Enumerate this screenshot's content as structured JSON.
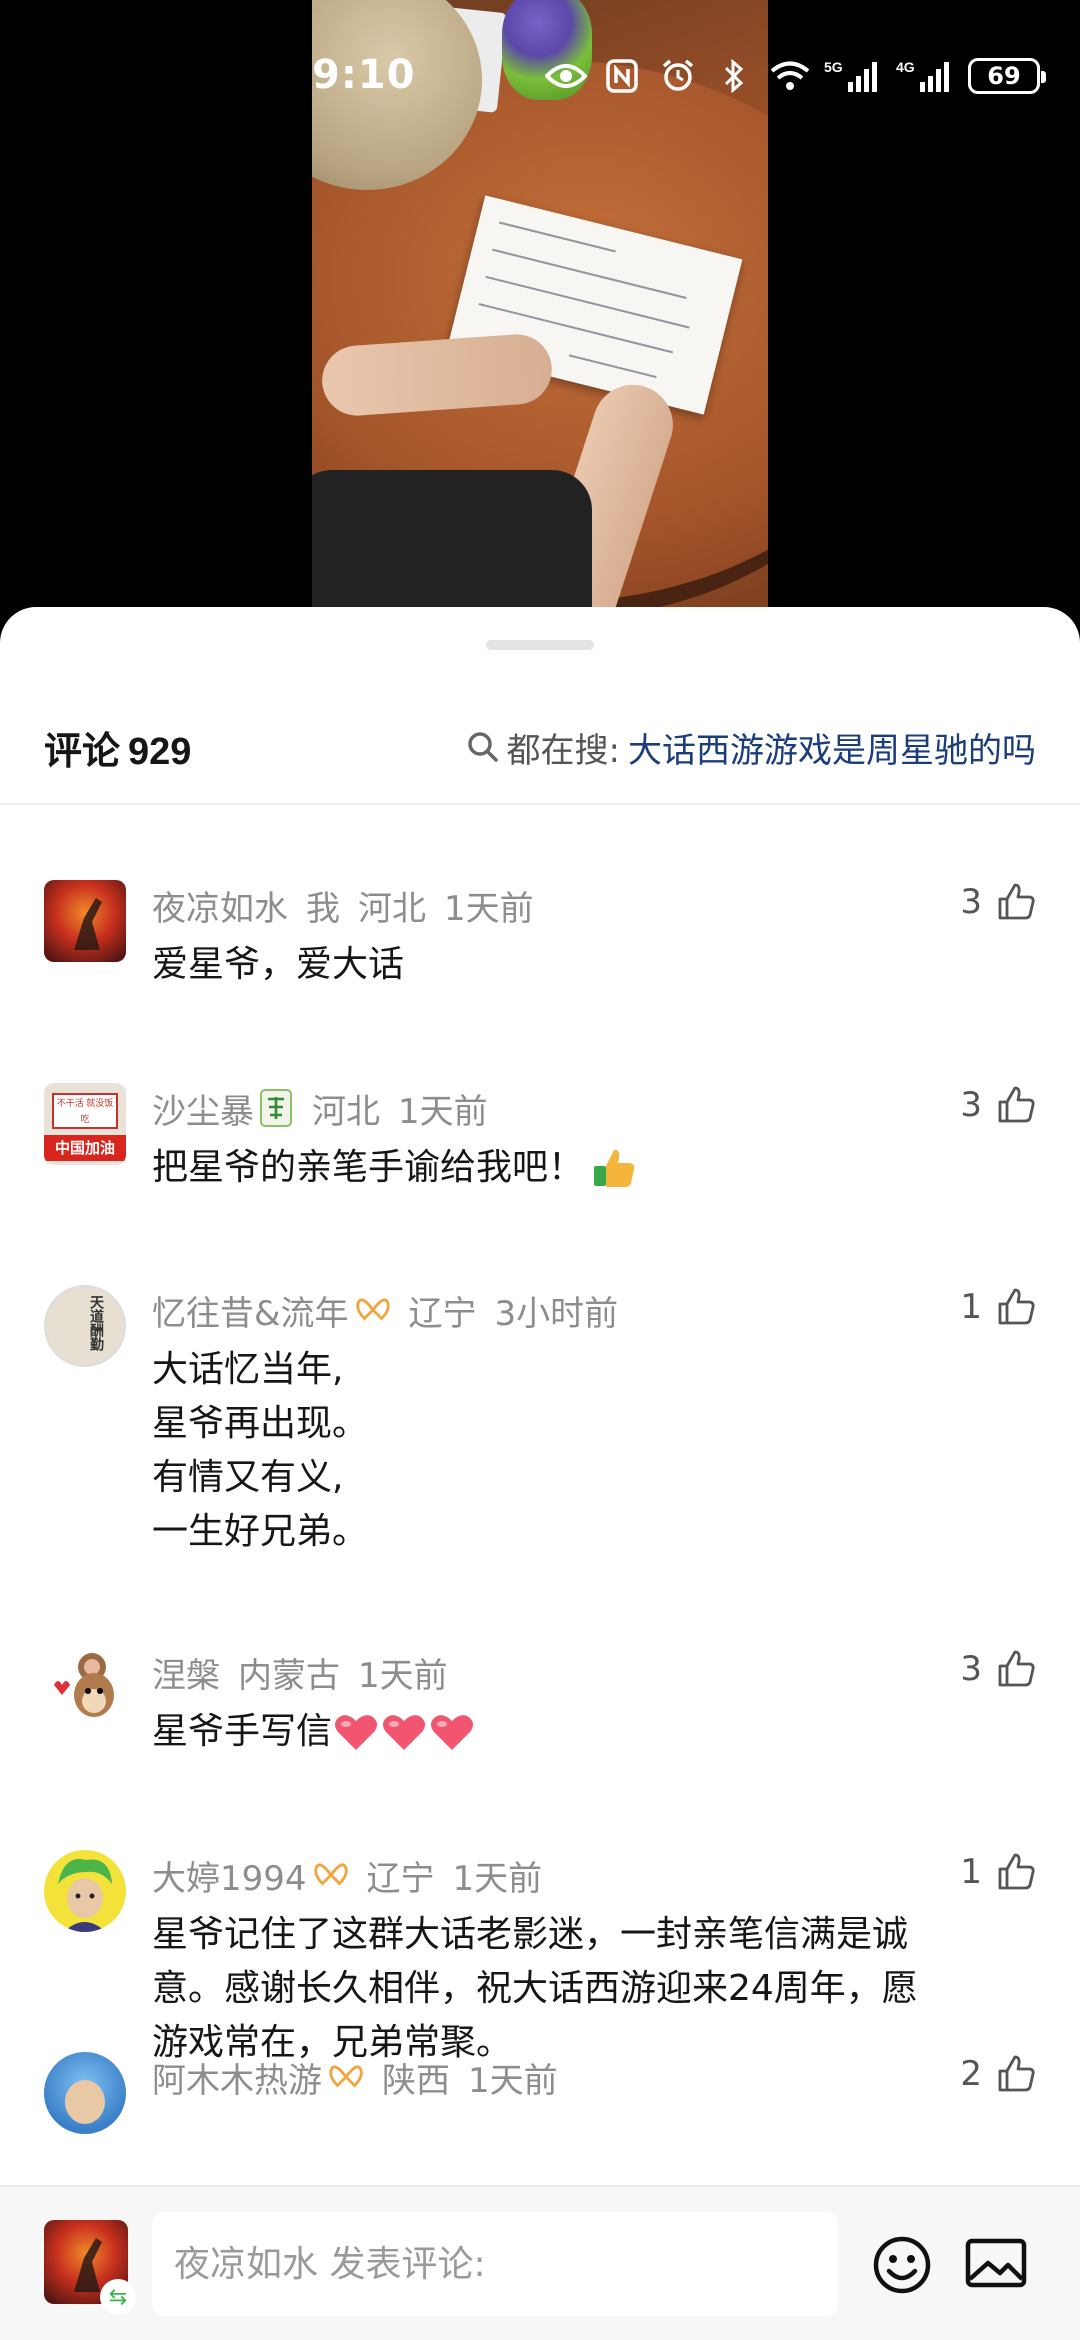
{
  "status_bar": {
    "time": "9:10",
    "battery": "69",
    "network": [
      "5G",
      "4G"
    ],
    "icons": [
      "eye-icon",
      "nfc-icon",
      "alarm-icon",
      "bluetooth-icon",
      "wifi-icon",
      "signal-5g-icon",
      "signal-4g-icon",
      "battery-icon"
    ]
  },
  "sheet": {
    "title": "评论",
    "count": "929",
    "search_label": "都在搜:",
    "search_query": "大话西游游戏是周星驰的吗"
  },
  "comments": [
    {
      "user": "夜凉如水",
      "tag": "我",
      "region": "河北",
      "time": "1天前",
      "likes": "3",
      "lines": [
        "爱星爷，爱大话"
      ]
    },
    {
      "user": "沙尘暴",
      "badge": "mahjong-fa-icon",
      "region": "河北",
      "time": "1天前",
      "likes": "3",
      "lines": [
        "把星爷的亲笔手谕给我吧！"
      ],
      "emoji": "thumbs-up-emoji"
    },
    {
      "user": "忆往昔&流年",
      "badge": "ribbon-icon",
      "region": "辽宁",
      "time": "3小时前",
      "likes": "1",
      "lines": [
        "大话忆当年,",
        "星爷再出现。",
        "有情又有义,",
        "一生好兄弟。"
      ]
    },
    {
      "user": "涅槃",
      "region": "内蒙古",
      "time": "1天前",
      "likes": "3",
      "lines": [
        "星爷手写信"
      ],
      "emoji": "heart-emoji"
    },
    {
      "user": "大婷1994",
      "badge": "ribbon-icon",
      "region": "辽宁",
      "time": "1天前",
      "likes": "1",
      "lines": [
        "星爷记住了这群大话老影迷，一封亲笔信满是诚",
        "意。感谢长久相伴，祝大话西游迎来24周年，愿",
        "游戏常在，兄弟常聚。"
      ]
    },
    {
      "user": "阿木木热游",
      "badge": "ribbon-icon",
      "region": "陕西",
      "time": "1天前",
      "likes": "2",
      "lines": []
    }
  ],
  "avatar_texts": {
    "shachenbao": "中国加油",
    "shachenbao_top": "不干活 就没饭吃",
    "yiwangxi": "天道酬勤"
  },
  "input_bar": {
    "placeholder": "夜凉如水 发表评论:"
  },
  "colors": {
    "link": "#1b3d7a",
    "meta": "#8d8d8d",
    "badge_orange": "#f0a640"
  }
}
